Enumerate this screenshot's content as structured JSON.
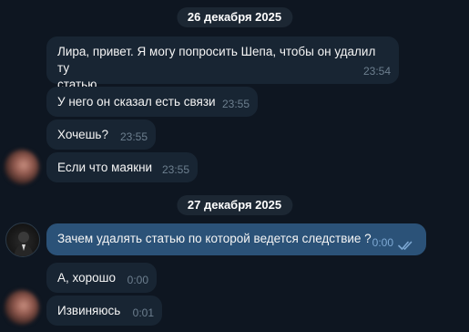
{
  "dates": [
    "26 декабря 2025",
    "27 декабря 2025"
  ],
  "messages": [
    {
      "text_line1": "Лира, привет. Я могу попросить Шепа, чтобы он удалил ту",
      "text_line2": "статью",
      "time": "23:54"
    },
    {
      "text": "У него он сказал есть связи",
      "time": "23:55"
    },
    {
      "text": "Хочешь?",
      "time": "23:55"
    },
    {
      "text": "Если что маякни",
      "time": "23:55"
    },
    {
      "text": "Зачем удалять статью по которой ведется следствие ?",
      "time": "0:00"
    },
    {
      "text": "А, хорошо",
      "time": "0:00"
    },
    {
      "text": "Извиняюсь",
      "time": "0:01"
    }
  ],
  "colors": {
    "background": "#0e1621",
    "incoming_bubble": "#182533",
    "outgoing_bubble": "#2b5278",
    "read_checks": "#7da8d3"
  },
  "icons": {
    "read_status": "double-check-icon",
    "contact_avatar": "avatar-blurred",
    "own_avatar": "avatar-photo"
  }
}
